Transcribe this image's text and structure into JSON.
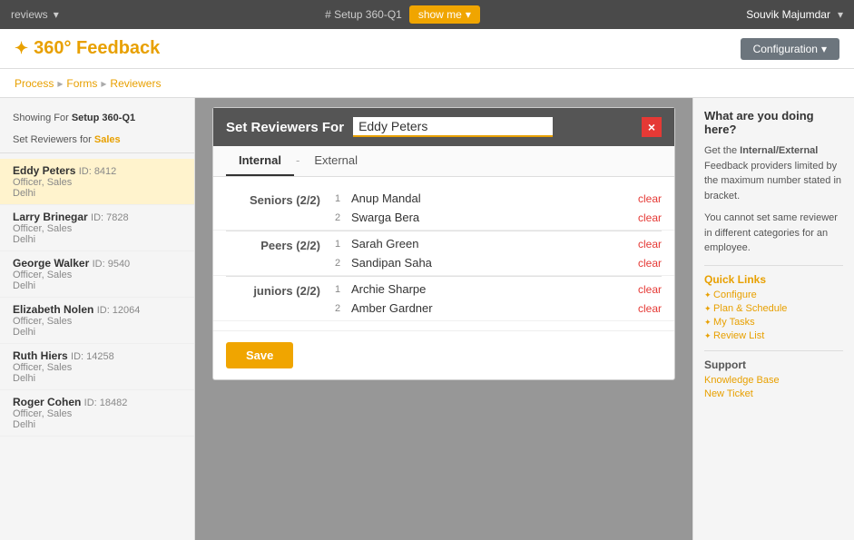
{
  "topbar": {
    "reviews_label": "reviews",
    "setup_label": "# Setup 360-Q1",
    "show_me_label": "show me",
    "username": "Souvik Majumdar"
  },
  "header": {
    "app_title": "360° Feedback",
    "config_label": "Configuration"
  },
  "nav": {
    "process": "Process",
    "forms": "Forms",
    "reviewers": "Reviewers"
  },
  "left_panel": {
    "showing_for_label": "Showing For",
    "showing_for_value": "Setup 360-Q1",
    "set_reviewers_label": "Set Reviewers for",
    "set_reviewers_value": "Sales",
    "people": [
      {
        "name": "Eddy Peters",
        "id": "ID: 8412",
        "role": "Officer, Sales",
        "dept": "Delhi",
        "active": true
      },
      {
        "name": "Larry Brinegar",
        "id": "ID: 7828",
        "role": "Officer, Sales",
        "dept": "Delhi",
        "active": false
      },
      {
        "name": "George Walker",
        "id": "ID: 9540",
        "role": "Officer, Sales",
        "dept": "Delhi",
        "active": false
      },
      {
        "name": "Elizabeth Nolen",
        "id": "ID: 12064",
        "role": "Officer, Sales",
        "dept": "Delhi",
        "active": false
      },
      {
        "name": "Ruth Hiers",
        "id": "ID: 14258",
        "role": "Officer, Sales",
        "dept": "Delhi",
        "active": false
      },
      {
        "name": "Roger Cohen",
        "id": "ID: 18482",
        "role": "Officer, Sales",
        "dept": "Delhi",
        "active": false
      }
    ]
  },
  "right_panel": {
    "help_title": "What are you doing here?",
    "help_text_1": "Get the ",
    "help_bold_1": "Internal/External",
    "help_text_2": " Feedback providers limited by the maximum number stated in bracket.",
    "help_text_3": "You cannot set same reviewer in different categories for an employee.",
    "quick_links_title": "Quick Links",
    "quick_links": [
      "Configure",
      "Plan & Schedule",
      "My Tasks",
      "Review List"
    ],
    "support_title": "Support",
    "support_links": [
      "Knowledge Base",
      "New Ticket"
    ]
  },
  "modal": {
    "title": "Set Reviewers For",
    "employee_name": "Eddy Peters",
    "close_label": "×",
    "tab_internal": "Internal",
    "tab_external": "External",
    "categories": [
      {
        "name": "Seniors (2/2)",
        "entries": [
          {
            "num": "1",
            "name": "Anup Mandal",
            "clear": "clear"
          },
          {
            "num": "2",
            "name": "Swarga Bera",
            "clear": "clear"
          }
        ]
      },
      {
        "name": "Peers (2/2)",
        "entries": [
          {
            "num": "1",
            "name": "Sarah Green",
            "clear": "clear"
          },
          {
            "num": "2",
            "name": "Sandipan Saha",
            "clear": "clear"
          }
        ]
      },
      {
        "name": "juniors (2/2)",
        "entries": [
          {
            "num": "1",
            "name": "Archie Sharpe",
            "clear": "clear"
          },
          {
            "num": "2",
            "name": "Amber Gardner",
            "clear": "clear"
          }
        ]
      }
    ],
    "save_label": "Save"
  }
}
